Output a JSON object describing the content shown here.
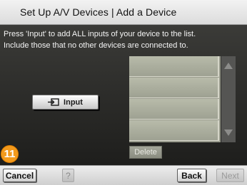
{
  "window": {
    "title": "Set Up A/V Devices | Add a Device"
  },
  "instructions": [
    "Press 'Input' to add ALL inputs of your device to the list.",
    "Include those that no other devices are connected to."
  ],
  "input_button": {
    "label": "Input",
    "icon": "input-connector-icon"
  },
  "input_list": {
    "rows": [
      "",
      "",
      "",
      ""
    ],
    "scroll_up_icon": "arrow-up-icon",
    "scroll_down_icon": "arrow-down-icon"
  },
  "delete_button": {
    "label": "Delete"
  },
  "footer": {
    "cancel_label": "Cancel",
    "help_label": "?",
    "back_label": "Back",
    "next_label": "Next"
  },
  "step_badge": "11",
  "colors": {
    "title_bar": "#e6e6e6",
    "content_bg": "#2c2c2a",
    "list_bg": "#a8ab9c",
    "badge": "#f39a1c"
  }
}
